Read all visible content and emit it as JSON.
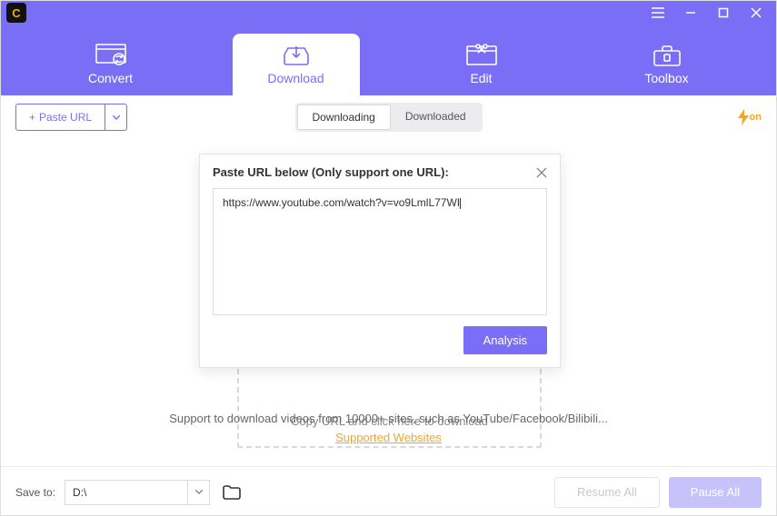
{
  "window": {
    "menu_icon": "menu-icon",
    "minimize_icon": "minimize-icon",
    "maximize_icon": "maximize-icon",
    "close_icon": "close-icon"
  },
  "tabs": {
    "convert": "Convert",
    "download": "Download",
    "edit": "Edit",
    "toolbox": "Toolbox",
    "active": "download"
  },
  "toolbar": {
    "paste_url_label": "Paste URL",
    "seg_downloading": "Downloading",
    "seg_downloaded": "Downloaded",
    "seg_active": "downloading",
    "hw_badge": "on"
  },
  "dropzone": {
    "hint": "Copy URL and click here to download"
  },
  "support": {
    "text": "Support to download videos from 10000+ sites, such as YouTube/Facebook/Bilibili...",
    "link": "Supported Websites"
  },
  "dialog": {
    "title": "Paste URL below (Only support one URL):",
    "url_value": "https://www.youtube.com/watch?v=vo9LmlL77WI",
    "analysis_label": "Analysis"
  },
  "bottom": {
    "save_to_label": "Save to:",
    "save_to_value": "D:\\",
    "resume_label": "Resume All",
    "pause_label": "Pause All"
  }
}
